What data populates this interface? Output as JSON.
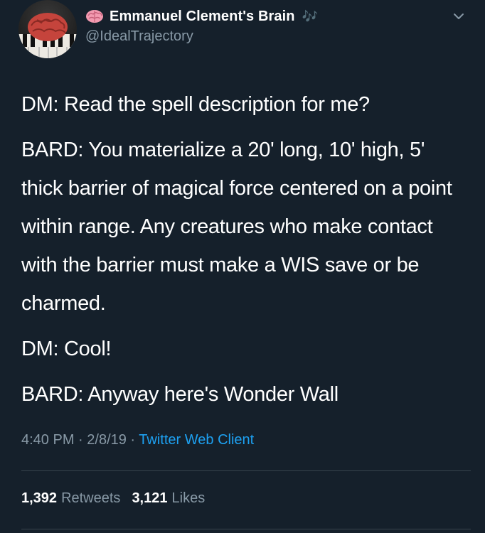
{
  "author": {
    "display_name": "Emmanuel Clement's Brain",
    "name_emoji": "brain-icon",
    "name_suffix": "🎶",
    "handle": "@IdealTrajectory"
  },
  "tweet": {
    "paragraphs": [
      "DM: Read the spell description for me?",
      "BARD: You materialize a 20' long, 10' high, 5' thick barrier of magical force centered on a point within range. Any creatures who make contact with the barrier must make a WIS save or be charmed.",
      "DM: Cool!",
      "BARD: Anyway here's Wonder Wall"
    ],
    "time": "4:40 PM",
    "sep1": " · ",
    "date": "2/8/19",
    "sep2": " · ",
    "client": "Twitter Web Client"
  },
  "stats": {
    "retweets_count": "1,392",
    "retweets_label": "Retweets",
    "likes_count": "3,121",
    "likes_label": "Likes"
  },
  "colors": {
    "background": "#15202b",
    "secondary_text": "#8899a6",
    "link": "#1da1f2"
  }
}
